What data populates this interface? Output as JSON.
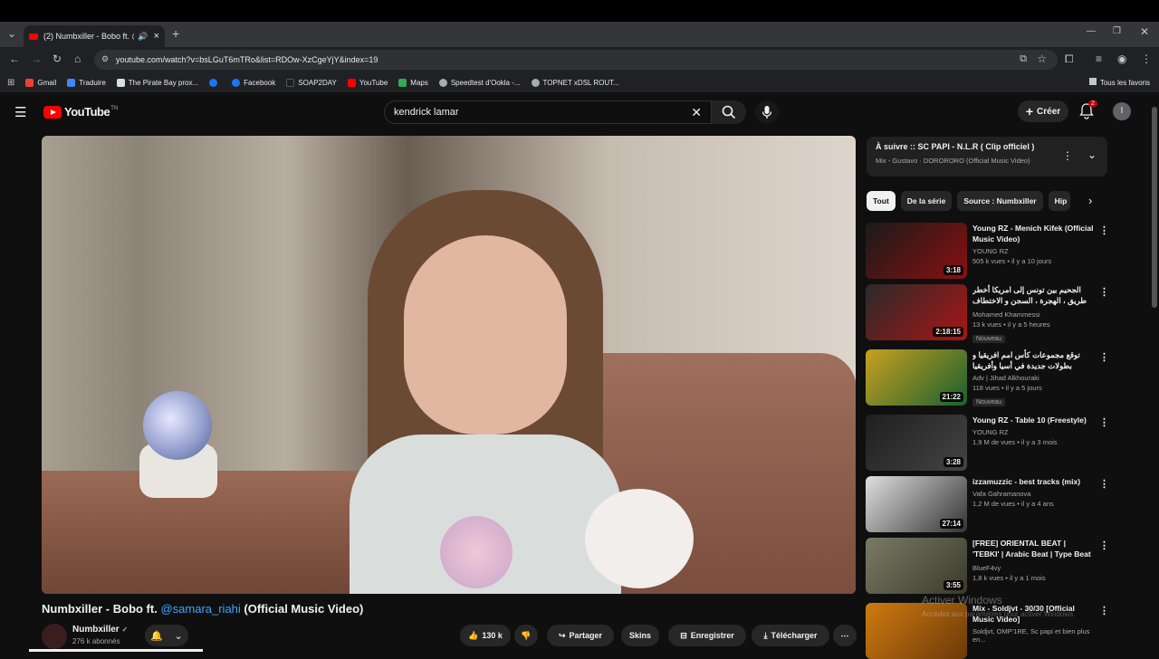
{
  "browser": {
    "tab_title": "(2) Numbxiller - Bobo ft. @",
    "url": "youtube.com/watch?v=bsLGuT6mTRo&list=RDOw-XzCgeYjY&index=19",
    "bookmarks": [
      {
        "label": "Gmail",
        "color": "#ea4335"
      },
      {
        "label": "Traduire",
        "color": "#4285f4"
      },
      {
        "label": "The Pirate Bay prox...",
        "color": "#dddddd"
      },
      {
        "label": "",
        "color": "#1877f2"
      },
      {
        "label": "Facebook",
        "color": "#1877f2"
      },
      {
        "label": "SOAP2DAY",
        "color": "#1e1e1e"
      },
      {
        "label": "YouTube",
        "color": "#ff0000"
      },
      {
        "label": "Maps",
        "color": "#34a853"
      },
      {
        "label": "Speedtest d'Ookla -...",
        "color": "#aaaaaa"
      },
      {
        "label": "TOPNET xDSL ROUT...",
        "color": "#aaaaaa"
      }
    ],
    "all_favorites": "Tous les favoris"
  },
  "youtube": {
    "logo_text": "YouTube",
    "logo_tm": "TN",
    "search_value": "kendrick lamar",
    "create_label": "Créer",
    "notif_count": "2",
    "avatar_letter": "I"
  },
  "video": {
    "title_prefix": "Numbxiller - Bobo ft. ",
    "title_link": "@samara_riahi",
    "title_suffix": " (Official Music Video)",
    "channel": "Numbxiller",
    "subscribers": "276 k abonnés",
    "likes": "130 k",
    "share": "Partager",
    "skins": "Skins",
    "save": "Enregistrer",
    "download": "Télécharger",
    "progress": 0.15
  },
  "sidebar": {
    "up_next_title": "À suivre :: SC PAPI - N.L.R ( Clip officiel )",
    "up_next_sub": "Mix - Gustavo · DORORORO (Official Music Video)",
    "chips": [
      "Tout",
      "De la série",
      "Source : Numbxiller",
      "Hip"
    ],
    "recs": [
      {
        "title": "Young RZ - Menich Kifek (Official Music Video)",
        "channel": "YOUNG RZ",
        "meta": "505 k vues • il y a 10 jours",
        "dur": "3:18",
        "badge": "",
        "thumb": "#1a1a1a",
        "thumb2": "#8a1010"
      },
      {
        "title": "الجحيم بين تونس إلى امريكا أخطر طريق ، الهجرة ، السجن و الاختطاف في المكسيك من",
        "channel": "Mohamed Khammessi",
        "meta": "13 k vues • il y a 5 heures",
        "dur": "2:18:15",
        "badge": "Nouveau",
        "thumb": "#2a2a2a",
        "thumb2": "#aa1515"
      },
      {
        "title": "توقع مجموعات كأس امم افريقيا و بطولات جديدة في أسيا وأفريقيا",
        "channel": "Adv | Jihad Alkhouraki",
        "meta": "118 vues • il y a 5 jours",
        "dur": "21:22",
        "badge": "Nouveau",
        "thumb": "#c8a020",
        "thumb2": "#1a6030"
      },
      {
        "title": "Young RZ - Table 10 (Freestyle)",
        "channel": "YOUNG RZ",
        "meta": "1,9 M de vues • il y a 3 mois",
        "dur": "3:28",
        "badge": "",
        "thumb": "#1f1f1f",
        "thumb2": "#444444"
      },
      {
        "title": "izzamuzzic - best tracks (mix)",
        "channel": "Vafa Gahramanova",
        "meta": "1,2 M de vues • il y a 4 ans",
        "dur": "27:14",
        "badge": "",
        "thumb": "#e0e0e0",
        "thumb2": "#333333"
      },
      {
        "title": "[FREE] ORIENTAL BEAT | 'TEBKI' | Arabic Beat | Type Beat | ...",
        "channel": "BlueF4vy",
        "meta": "1,8 k vues • il y a 1 mois",
        "dur": "3:55",
        "badge": "",
        "thumb": "#7a7a66",
        "thumb2": "#3a3a2a"
      },
      {
        "title": "Mix - Soldjvt - 30/30 [Official Music Video]",
        "channel": "Soldjvt, OMP'1RE, Sc papi et bien plus en...",
        "meta": "",
        "dur": "",
        "badge": "",
        "thumb": "#d07a10",
        "thumb2": "#6a3a08"
      }
    ]
  },
  "watermark": {
    "line1": "Activer Windows",
    "line2": "Accédez aux paramètres pour activer Windows."
  },
  "colors": {
    "accent": "#ff0000",
    "link": "#3ea6ff",
    "bg": "#0f0f0f"
  }
}
